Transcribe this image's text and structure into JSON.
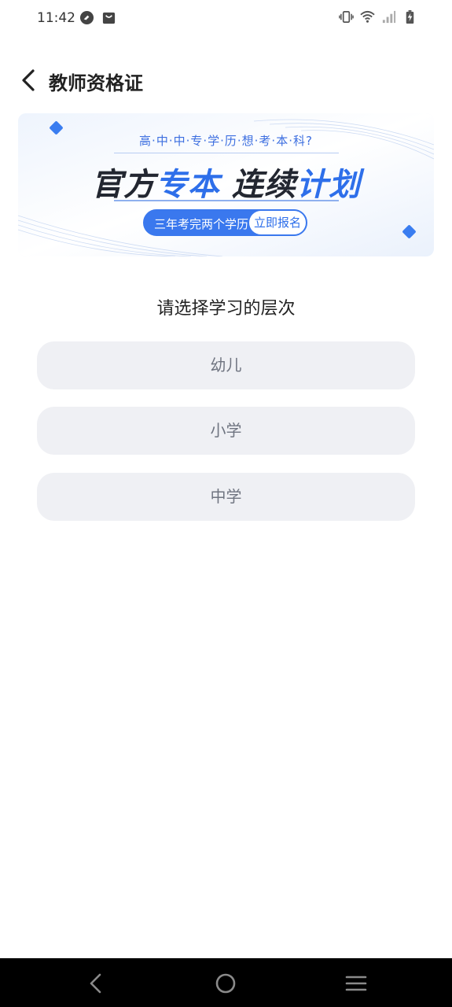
{
  "status_bar": {
    "time": "11:42",
    "left_icons": [
      "app-icon",
      "shopping-bag-icon"
    ],
    "right_icons": [
      "vibrate-icon",
      "wifi-icon",
      "cellular-signal-icon",
      "battery-charging-icon"
    ]
  },
  "header": {
    "title": "教师资格证",
    "back_icon": "chevron-left-icon"
  },
  "banner": {
    "subtitle": "高·中·中·专·学·历·想·考·本·科?",
    "title_part1": "官方",
    "title_part2": "专本",
    "title_part3": "连续",
    "title_part4": "计划",
    "pill_text": "三年考完两个学历",
    "pill_button": "立即报名",
    "accent_color": "#2e6fea"
  },
  "main": {
    "prompt": "请选择学习的层次",
    "options": [
      {
        "label": "幼儿"
      },
      {
        "label": "小学"
      },
      {
        "label": "中学"
      }
    ]
  },
  "nav_bar": {
    "buttons": [
      "back-triangle-icon",
      "home-circle-icon",
      "menu-icon"
    ]
  }
}
